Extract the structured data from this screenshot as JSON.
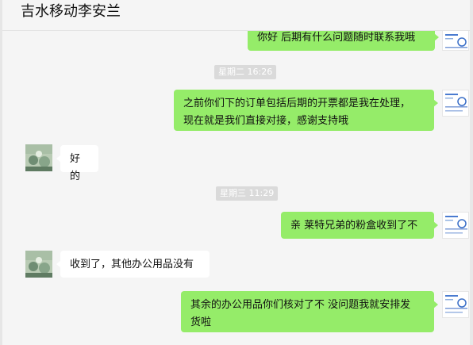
{
  "chat": {
    "title": "吉水移动李安兰"
  },
  "messages": [
    {
      "kind": "out",
      "text": "你好 后期有什么问题随时联系我哦"
    },
    {
      "kind": "time",
      "text": "星期二 16:26"
    },
    {
      "kind": "out",
      "text": "之前你们下的订单包括后期的开票都是我在处理，\n现在就是我们直接对接，感谢支持哦"
    },
    {
      "kind": "in",
      "text": "好的"
    },
    {
      "kind": "time",
      "text": "星期三 11:29"
    },
    {
      "kind": "out",
      "text": "亲 莱特兄弟的粉盒收到了不"
    },
    {
      "kind": "in",
      "text": "收到了，其他办公用品没有"
    },
    {
      "kind": "out",
      "text": "其余的办公用品你们核对了不 没问题我就安排发\n货啦"
    }
  ],
  "colors": {
    "outgoing_bubble": "#95ec69",
    "incoming_bubble": "#ffffff",
    "timestamp_bg": "#dadada",
    "background": "#f5f5f5"
  }
}
